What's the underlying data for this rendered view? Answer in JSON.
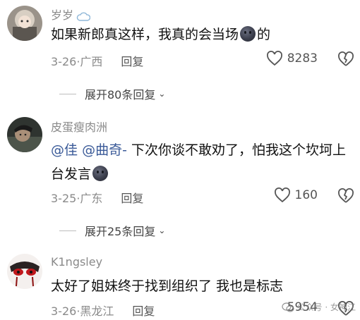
{
  "comments": [
    {
      "username": "岁岁",
      "text": "如果新郎真这样，我真的会当场",
      "text_tail": "的",
      "date": "3-26",
      "location": "广西",
      "reply_label": "回复",
      "likes": "8283",
      "expand_label": "展开80条回复"
    },
    {
      "username": "皮蛋瘦肉洲",
      "mention1": "@佳",
      "mention2": "@曲奇-",
      "text": "下次你谈不敢劝了，怕我这个坎坷上台发言",
      "date": "3-25",
      "location": "广东",
      "reply_label": "回复",
      "likes": "160",
      "expand_label": "展开25条回复"
    },
    {
      "username": "K1ngsley",
      "text": "太好了姐妹终于找到组织了 我也是标志",
      "date": "3-26",
      "location": "黑龙江",
      "reply_label": "回复",
      "likes": "5954"
    }
  ],
  "watermark": "公众号 · 女神江",
  "icons": {
    "cloud": "cloud-badge-icon",
    "like": "heart-outline-icon",
    "dislike": "broken-heart-icon",
    "expand": "chevron-down-icon",
    "emoji": "dark-face-emoji-icon"
  }
}
